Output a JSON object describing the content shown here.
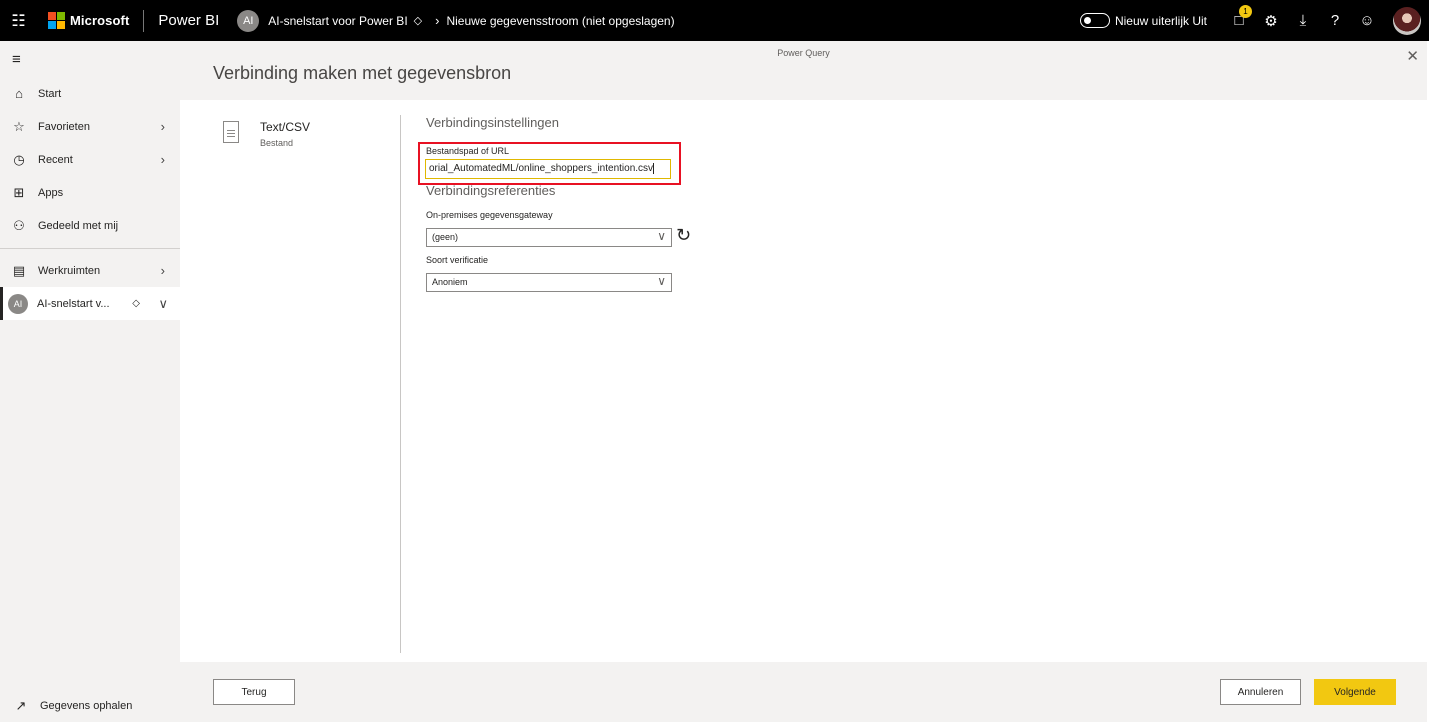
{
  "topbar": {
    "brand": "Microsoft",
    "product": "Power BI",
    "workspace_initials": "AI",
    "breadcrumb_workspace": "AI-snelstart voor Power BI",
    "breadcrumb_page": "Nieuwe gegevensstroom (niet opgeslagen)",
    "toggle_label": "Nieuw uiterlijk Uit",
    "notification_count": "1"
  },
  "nav": {
    "items": [
      {
        "label": "Start",
        "icon": "home-icon"
      },
      {
        "label": "Favorieten",
        "icon": "star-icon"
      },
      {
        "label": "Recent",
        "icon": "clock-icon"
      },
      {
        "label": "Apps",
        "icon": "apps-icon"
      },
      {
        "label": "Gedeeld met mij",
        "icon": "shared-icon"
      }
    ],
    "workspaces_label": "Werkruimten",
    "active_workspace_label": "AI-snelstart v...",
    "get_data_label": "Gegevens ophalen"
  },
  "dialog": {
    "app_label": "Power Query",
    "title": "Verbinding maken met gegevensbron",
    "connector_name": "Text/CSV",
    "connector_sub": "Bestand",
    "settings_title": "Verbindingsinstellingen",
    "url_label": "Bestandspad of URL",
    "url_value": "orial_AutomatedML/online_shoppers_intention.csv",
    "credentials_title": "Verbindingsreferenties",
    "gateway_label": "On-premises gegevensgateway",
    "gateway_value": "(geen)",
    "auth_label": "Soort verificatie",
    "auth_value": "Anoniem",
    "back_label": "Terug",
    "cancel_label": "Annuleren",
    "next_label": "Volgende"
  },
  "colors": {
    "accent": "#f2c811",
    "highlight": "#e81123",
    "ms_red": "#f25022",
    "ms_green": "#7fba00",
    "ms_blue": "#00a4ef",
    "ms_yellow": "#ffb900"
  }
}
